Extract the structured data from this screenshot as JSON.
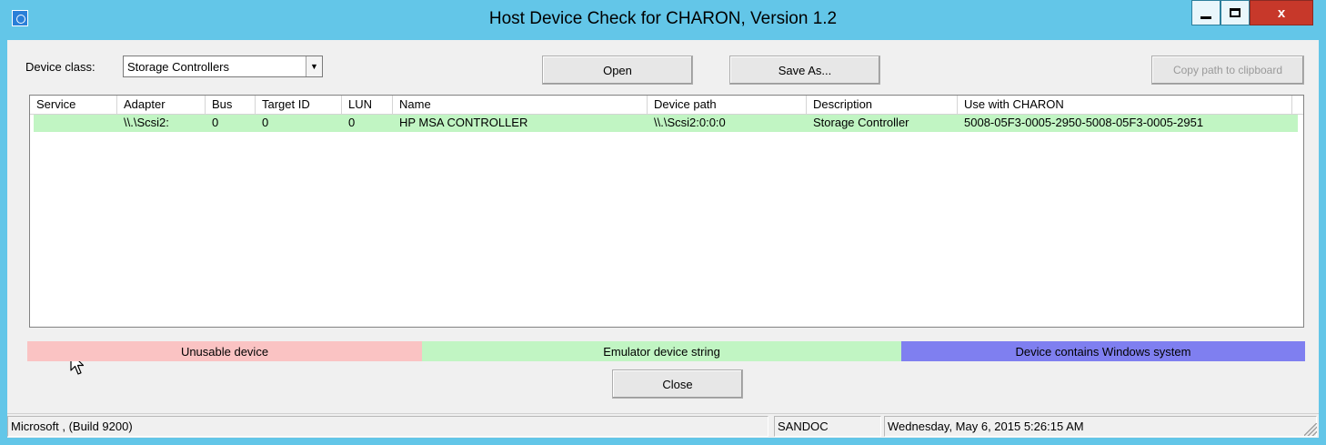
{
  "window": {
    "title": "Host Device Check for CHARON, Version 1.2",
    "minimize_glyph": "–",
    "maximize_glyph": "□",
    "close_glyph": "x",
    "icons": {
      "app": "app-icon",
      "minimize": "minimize-icon",
      "maximize": "maximize-icon",
      "close": "close-icon"
    },
    "colors": {
      "titlebar": "#63c6e8",
      "close": "#c7382a"
    }
  },
  "toolbar": {
    "device_class_label": "Device class:",
    "device_class_value": "Storage Controllers",
    "open_label": "Open",
    "save_as_label": "Save As...",
    "copy_path_label": "Copy path to clipboard",
    "copy_path_enabled": false
  },
  "device_list": {
    "columns": [
      "Service",
      "Adapter",
      "Bus",
      "Target ID",
      "LUN",
      "Name",
      "Device path",
      "Description",
      "Use with CHARON"
    ],
    "rows": [
      {
        "service": "",
        "adapter": "\\\\.\\Scsi2:",
        "bus": "0",
        "target_id": "0",
        "lun": "0",
        "name": "HP MSA CONTROLLER",
        "device_path": "\\\\.\\Scsi2:0:0:0",
        "description": "Storage Controller",
        "use_with_charon": "5008-05F3-0005-2950-5008-05F3-0005-2951",
        "status": "emulator"
      }
    ]
  },
  "legend": {
    "unusable_label": "Unusable device",
    "unusable_color": "#fac3c3",
    "emulator_label": "Emulator device string",
    "emulator_color": "#c1f5c3",
    "windows_label": "Device contains Windows system",
    "windows_color": "#7f7ff0"
  },
  "footer": {
    "close_label": "Close"
  },
  "statusbar": {
    "os": "Microsoft , (Build 9200)",
    "host": "SANDOC",
    "datetime": "Wednesday, May 6, 2015 5:26:15 AM"
  }
}
